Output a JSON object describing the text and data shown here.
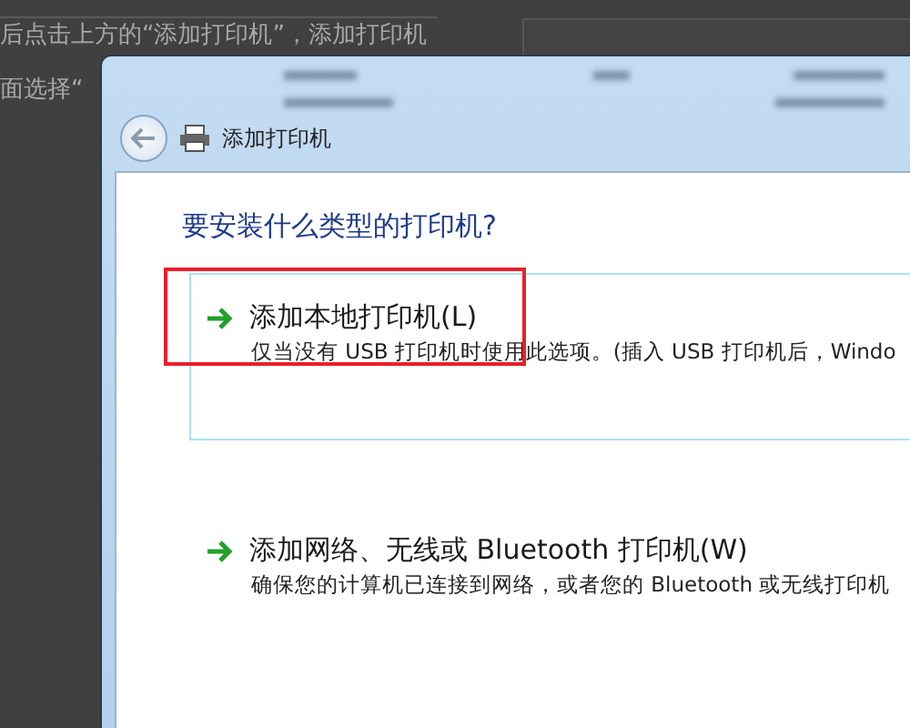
{
  "background_text": [
    "后点击上方的“添加打印机”，添加打印机",
    "面选择“"
  ],
  "dialog": {
    "title": "添加打印机",
    "heading": "要安装什么类型的打印机?",
    "options": [
      {
        "title": "添加本地打印机(L)",
        "description": "仅当没有 USB 打印机时使用此选项。(插入 USB 打印机后，Windo",
        "selected": true,
        "highlighted": true
      },
      {
        "title": "添加网络、无线或 Bluetooth 打印机(W)",
        "description": "确保您的计算机已连接到网络，或者您的 Bluetooth 或无线打印机",
        "selected": false,
        "highlighted": false
      }
    ]
  }
}
